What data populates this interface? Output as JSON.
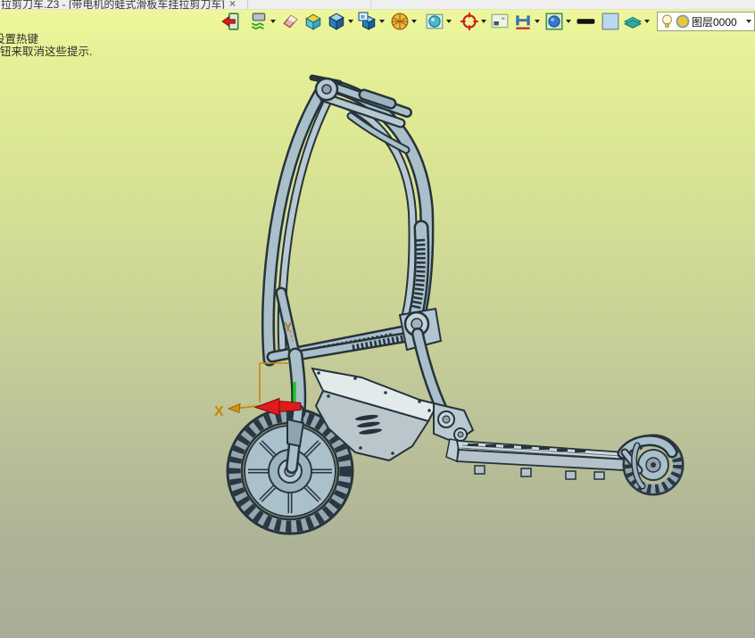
{
  "window": {
    "tab_title": "拉剪刀车.Z3 - [带电机的蛙式滑板车挂拉剪刀车]",
    "tab_close_label": "×"
  },
  "hints": {
    "line1": "设置热键",
    "line2": "钮来取消这些提示."
  },
  "toolbar": {
    "buttons": [
      {
        "name": "exit"
      },
      {
        "name": "visual-style",
        "has_dropdown": true
      },
      {
        "name": "eraser"
      },
      {
        "name": "isometric-box"
      },
      {
        "name": "shaded-cube",
        "has_dropdown": true
      },
      {
        "name": "window-cube",
        "has_dropdown": true
      },
      {
        "name": "wireframe-sphere",
        "has_dropdown": true
      },
      {
        "name": "sphere-in-box",
        "has_dropdown": true
      },
      {
        "name": "target",
        "has_dropdown": true
      },
      {
        "name": "viewport-layout"
      },
      {
        "name": "dimension-h",
        "has_dropdown": true
      },
      {
        "name": "render-sphere",
        "has_dropdown": true
      },
      {
        "name": "line-width"
      },
      {
        "name": "color-swatch"
      },
      {
        "name": "layers-book",
        "has_dropdown": true
      }
    ],
    "layer_combo": {
      "value": "图层0000",
      "icons": [
        "bulb-icon",
        "layer-color-icon"
      ]
    }
  },
  "viewport": {
    "axis_labels": {
      "x": "X",
      "y": "Y"
    },
    "colors": {
      "background_top": "#eef79b",
      "background_bottom": "#a9ad98",
      "model_body": "#a9bfca",
      "model_panel": "#e2eaec",
      "model_outline": "#26333b",
      "axis_x_arrow": "#e01b1b",
      "axis_frame": "#c8860a",
      "axis_green": "#1ec51e"
    },
    "model_name": "folding-electric-scooter"
  }
}
